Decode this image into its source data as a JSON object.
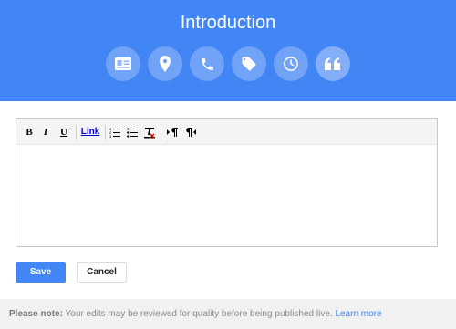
{
  "header": {
    "title": "Introduction",
    "background": "#4285f4",
    "steps": [
      {
        "icon": "contact-card-icon"
      },
      {
        "icon": "location-pin-icon"
      },
      {
        "icon": "phone-icon"
      },
      {
        "icon": "tag-icon"
      },
      {
        "icon": "clock-icon"
      },
      {
        "icon": "quote-icon",
        "active": true
      }
    ]
  },
  "toolbar": {
    "bold": "B",
    "italic": "I",
    "underline": "U",
    "link": "Link"
  },
  "editor": {
    "value": ""
  },
  "buttons": {
    "save": "Save",
    "cancel": "Cancel"
  },
  "note": {
    "label": "Please note:",
    "text": " Your edits may be reviewed for quality before being published live. ",
    "link": "Learn more"
  }
}
